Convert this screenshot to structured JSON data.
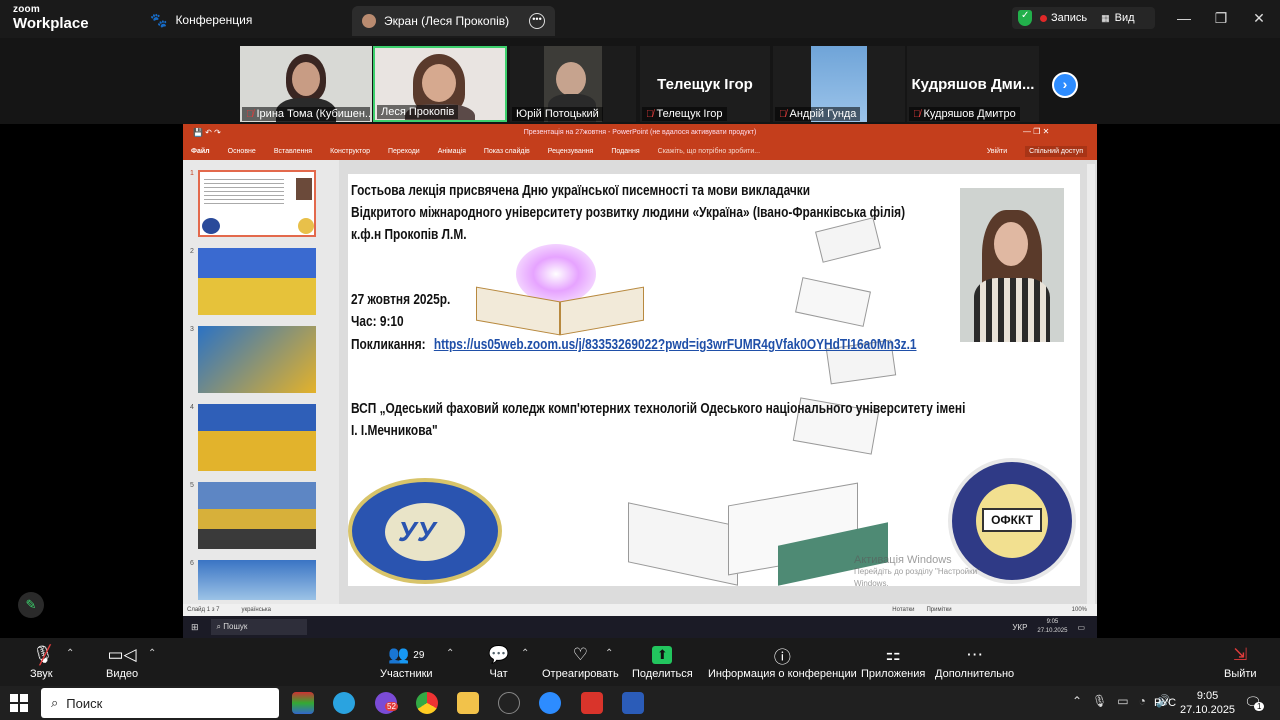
{
  "titlebar": {
    "logo_line1": "zoom",
    "logo_line2": "Workplace",
    "conference_tab": "Конференция",
    "screen_tab": "Экран (Леся Прокопів)",
    "record_label": "Запись",
    "view_label": "Вид"
  },
  "participants": [
    {
      "name": "Ірина Тома (Кубишен..."
    },
    {
      "name": "Леся Прокопів"
    },
    {
      "name": "Юрій Потоцький"
    },
    {
      "name": "Телещук Ігор",
      "big": "Телещук Ігор"
    },
    {
      "name": "Андрій Гунда"
    },
    {
      "name": "Кудряшов Дмитро",
      "big": "Кудряшов  Дми..."
    }
  ],
  "powerpoint": {
    "title": "Презентація на 27жовтня - PowerPoint (не вдалося активувати продукт)",
    "tabs": [
      "Файл",
      "Основне",
      "Вставлення",
      "Конструктор",
      "Переходи",
      "Анімація",
      "Показ слайдів",
      "Рецензування",
      "Подання",
      "Скажіть, що потрібно зробити..."
    ],
    "signin": "Увійти",
    "share": "Спільний доступ",
    "slide_numbers": [
      "1",
      "2",
      "3",
      "4",
      "5",
      "6"
    ],
    "status_slide": "Слайд 1 з 7",
    "status_lang": "українська",
    "notes": "Нотатки",
    "comments": "Примітки",
    "zoom": "100%",
    "taskbar_search": "Пошук",
    "taskbar_lang": "УКР",
    "taskbar_time": "9:05",
    "taskbar_date": "27.10.2025"
  },
  "slide": {
    "line1": "Гостьова лекція присвячена Дню української писемності та мови викладачки",
    "line2": "Відкритого міжнародного університету розвитку людини «Україна» (Івано-Франківська філія)",
    "line3": "к.ф.н Прокопів Л.М.",
    "date": "27 жовтня 2025р.",
    "time": "Час: 9:10",
    "link_label": "Покликання:",
    "link": "https://us05web.zoom.us/j/83353269022?pwd=ig3wrFUMR4gVfak0OYHdTI16a0Mn3z.1",
    "college1": "ВСП „Одеський фаховий коледж комп'ютерних технологій Одеського національного університету імені",
    "college2": "І. І.Мечникова\"",
    "logo_right": "ОФККТ",
    "watermark1": "Активація Windows",
    "watermark2": "Перейдіть до розділу \"Настройки\"",
    "watermark3": "Windows."
  },
  "toolbar": {
    "audio": "Звук",
    "video": "Видео",
    "participants": "Участники",
    "participants_count": "29",
    "chat": "Чат",
    "react": "Отреагировать",
    "share": "Поделиться",
    "info": "Информация о конференции",
    "apps": "Приложения",
    "more": "Дополнительно",
    "leave": "Выйти"
  },
  "taskbar": {
    "search": "Поиск",
    "lang": "РУС",
    "time": "9:05",
    "date": "27.10.2025",
    "badge": "52",
    "notif": "1"
  }
}
